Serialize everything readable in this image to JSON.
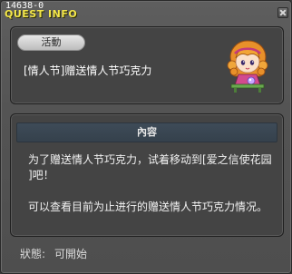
{
  "window": {
    "quest_id": "14638-0",
    "title": "QUEST INFO"
  },
  "quest": {
    "category": "活動",
    "name": "[情人节]赠送情人节巧克力",
    "npc_icon": "npc-girl-portrait-icon"
  },
  "content": {
    "header": "內容",
    "line1": "为了赠送情人节巧克力，试着移动到[爱之信使花园",
    "line2": "]吧！",
    "line3": "可以查看目前为止进行的赠送情人节巧克力情况。"
  },
  "status": {
    "label": "狀態:",
    "value": "可開始"
  },
  "colors": {
    "title": "#f3e64a",
    "window_bg": "#555555",
    "panel_bg": "#444444",
    "header_bg": "#3b4854"
  }
}
